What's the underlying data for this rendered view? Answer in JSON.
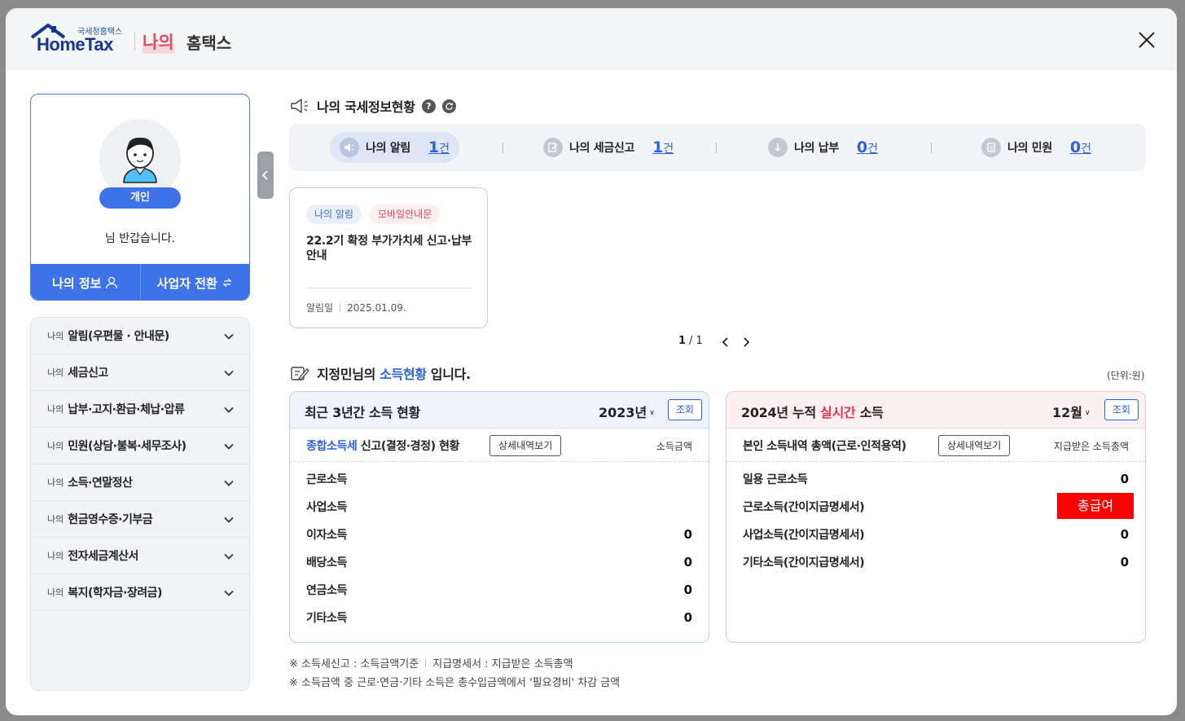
{
  "header": {
    "logo_small": "국세청홈택스",
    "logo_big": "HomeTax",
    "brand_my": "나의",
    "brand_hometax": "홈택스",
    "close_icon": "close-icon"
  },
  "profile": {
    "badge": "개인",
    "greeting": "님 반갑습니다.",
    "my_info": "나의 정보",
    "switch_business": "사업자 전환"
  },
  "menu": {
    "items": [
      {
        "prefix": "나의",
        "label": "알림(우편물 · 안내문)"
      },
      {
        "prefix": "나의",
        "label": "세금신고"
      },
      {
        "prefix": "나의",
        "label": "납부·고지·환급·체납·압류"
      },
      {
        "prefix": "나의",
        "label": "민원(상담·불복·세무조사)"
      },
      {
        "prefix": "나의",
        "label": "소득·연말정산"
      },
      {
        "prefix": "나의",
        "label": "현금영수증·기부금"
      },
      {
        "prefix": "나의",
        "label": "전자세금계산서"
      },
      {
        "prefix": "나의",
        "label": "복지(학자금·장려금)"
      }
    ]
  },
  "status": {
    "title": "나의 국세정보현황",
    "help": "?",
    "items": [
      {
        "label": "나의 알림",
        "count": "1",
        "unit": "건"
      },
      {
        "label": "나의 세금신고",
        "count": "1",
        "unit": "건"
      },
      {
        "label": "나의 납부",
        "count": "0",
        "unit": "건"
      },
      {
        "label": "나의 민원",
        "count": "0",
        "unit": "건"
      }
    ]
  },
  "notice": {
    "tag1": "나의 알림",
    "tag2": "모바일안내문",
    "title": "22.2기 확정 부가가치세 신고·납부 안내",
    "date_label": "알림일",
    "date": "2025.01.09."
  },
  "pager": {
    "current": "1",
    "sep": "/",
    "total": "1"
  },
  "income": {
    "title_prefix": "지정민님의",
    "title_hl": "소득현황",
    "title_suffix": "입니다.",
    "unit": "(단위:원)"
  },
  "left_box": {
    "title": "최근 3년간 소득 현황",
    "year": "2023년",
    "query": "조회",
    "sub_hl": "종합소득세",
    "sub_title": "신고(결정·경정) 현황",
    "detail": "상세내역보기",
    "col": "소득금액",
    "rows": [
      {
        "label": "근로소득",
        "value": ""
      },
      {
        "label": "사업소득",
        "value": ""
      },
      {
        "label": "이자소득",
        "value": "0"
      },
      {
        "label": "배당소득",
        "value": "0"
      },
      {
        "label": "연금소득",
        "value": "0"
      },
      {
        "label": "기타소득",
        "value": "0"
      }
    ]
  },
  "right_box": {
    "title_prefix": "2024년 누적",
    "title_realtime": "실시간",
    "title_suffix": "소득",
    "month": "12월",
    "query": "조회",
    "sub_title": "본인 소득내역 총액(근로·인적용역)",
    "detail": "상세내역보기",
    "col": "지급받은 소득총액",
    "rows": [
      {
        "label": "일용 근로소득",
        "value": "0"
      },
      {
        "label": "근로소득(간이지급명세서)",
        "value": ""
      },
      {
        "label": "사업소득(간이지급명세서)",
        "value": "0"
      },
      {
        "label": "기타소득(간이지급명세서)",
        "value": "0"
      }
    ],
    "total_pay_button": "총급여"
  },
  "footnotes": {
    "line1_a": "※ 소득세신고 : 소득금액기준",
    "line1_b": "지급명세서 : 지급받은 소득총액",
    "line2": "※ 소득금액 중 근로·연금·기타 소득은 총수입금액에서 '필요경비' 차감 금액"
  }
}
